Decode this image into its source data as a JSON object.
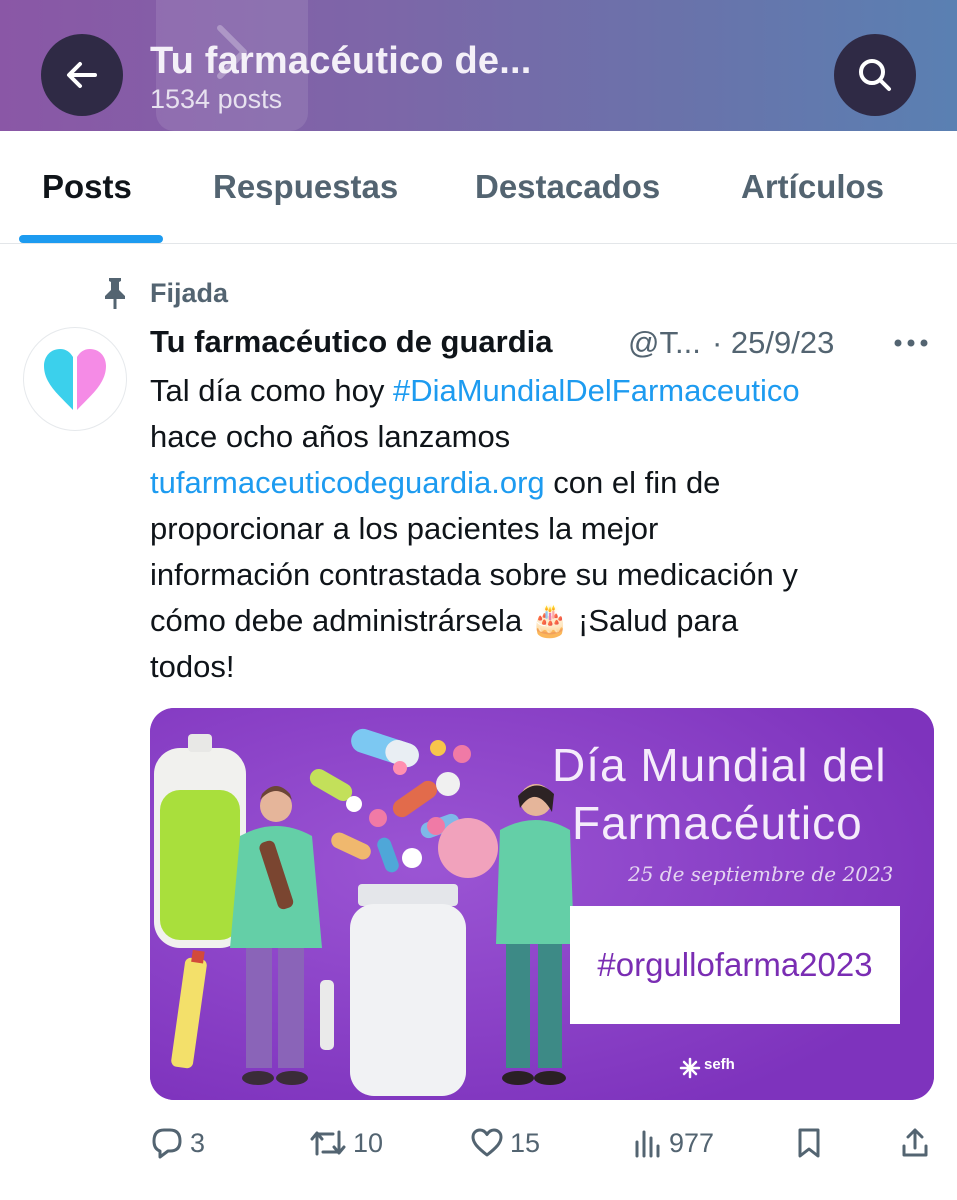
{
  "header": {
    "title": "Tu farmacéutico de...",
    "subtitle": "1534 posts",
    "back_icon": "arrow-left-icon",
    "search_icon": "search-icon"
  },
  "tabs": [
    {
      "label": "Posts",
      "active": true
    },
    {
      "label": "Respuestas",
      "active": false
    },
    {
      "label": "Destacados",
      "active": false
    },
    {
      "label": "Artículos",
      "active": false
    }
  ],
  "pinned": {
    "label": "Fijada",
    "icon": "pin-icon"
  },
  "tweet": {
    "author_name": "Tu farmacéutico de guardia",
    "handle": "@T...",
    "date": "· 25/9/23",
    "text_lines": {
      "l1_prefix": "Tal día como hoy ",
      "l1_hashtag": "#DiaMundialDelFarmaceutico",
      "l2": "hace ocho años lanzamos",
      "l3_link": "tufarmaceuticodeguardia.org",
      "l3_suffix": " con el fin de",
      "l4": "proporcionar a los pacientes la mejor",
      "l5": "información contrastada sobre su medicación y",
      "l6_prefix": "cómo debe administrársela ",
      "l6_emoji": "🎂",
      "l6_suffix": " ¡Salud para",
      "l7": "todos!"
    },
    "media": {
      "title_line1": "Día Mundial del",
      "title_line2": "Farmacéutico",
      "date": "25 de septiembre de 2023",
      "hashtag": "#orgullofarma2023",
      "logo": "sefh"
    },
    "actions": {
      "replies": "3",
      "retweets": "10",
      "likes": "15",
      "views": "977"
    }
  },
  "colors": {
    "accent": "#1d9bf0",
    "header_gradient_start": "#8a57a6",
    "header_gradient_end": "#5a80b2",
    "media_background": "#8a3fc7",
    "secondary_text": "#536471"
  }
}
